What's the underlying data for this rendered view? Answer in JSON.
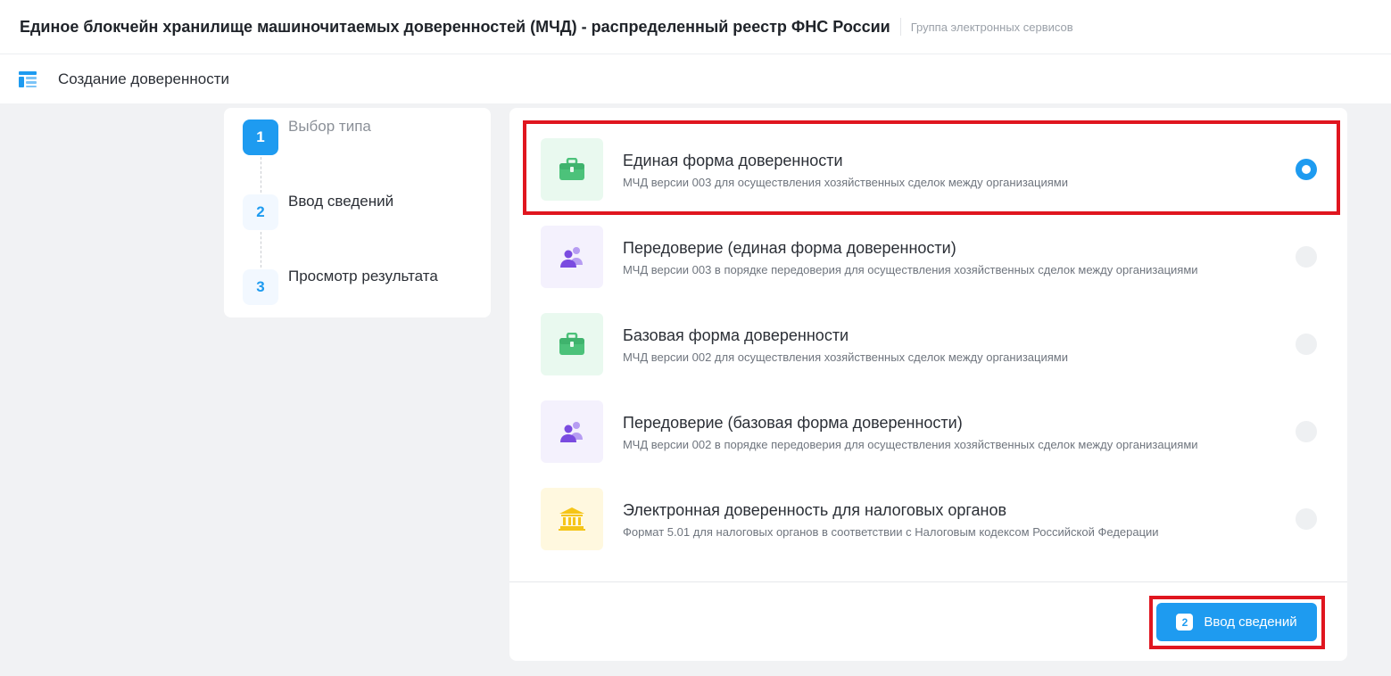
{
  "header": {
    "title": "Единое блокчейн хранилище машиночитаемых доверенностей (МЧД) - распределенный реестр ФНС России",
    "subtitle": "Группа электронных сервисов"
  },
  "page": {
    "title": "Создание доверенности",
    "icon": "layout-icon"
  },
  "steps": [
    {
      "num": "1",
      "label": "Выбор типа",
      "active": true
    },
    {
      "num": "2",
      "label": "Ввод сведений",
      "active": false
    },
    {
      "num": "3",
      "label": "Просмотр результата",
      "active": false
    }
  ],
  "options": [
    {
      "title": "Единая форма доверенности",
      "desc": "МЧД версии 003 для осуществления хозяйственных сделок между организациями",
      "icon": "briefcase-icon",
      "selected": true
    },
    {
      "title": "Передоверие (единая форма доверенности)",
      "desc": "МЧД версии 003 в порядке передоверия для осуществления хозяйственных сделок между организациями",
      "icon": "users-icon",
      "selected": false
    },
    {
      "title": "Базовая форма доверенности",
      "desc": "МЧД версии 002 для осуществления хозяйственных сделок между организациями",
      "icon": "briefcase-icon",
      "selected": false
    },
    {
      "title": "Передоверие (базовая форма доверенности)",
      "desc": "МЧД версии 002 в порядке передоверия для осуществления хозяйственных сделок между организациями",
      "icon": "users-icon",
      "selected": false
    },
    {
      "title": "Электронная доверенность для налоговых органов",
      "desc": "Формат 5.01 для налоговых органов в соответствии с Налоговым кодексом Российской Федерации",
      "icon": "bank-icon",
      "selected": false
    }
  ],
  "next_button": {
    "num": "2",
    "label": "Ввод сведений"
  },
  "colors": {
    "accent": "#1e9bf0",
    "highlight": "#e0161f",
    "green": "#4cc27a",
    "purple": "#7a4be0",
    "yellow": "#f5c518"
  }
}
